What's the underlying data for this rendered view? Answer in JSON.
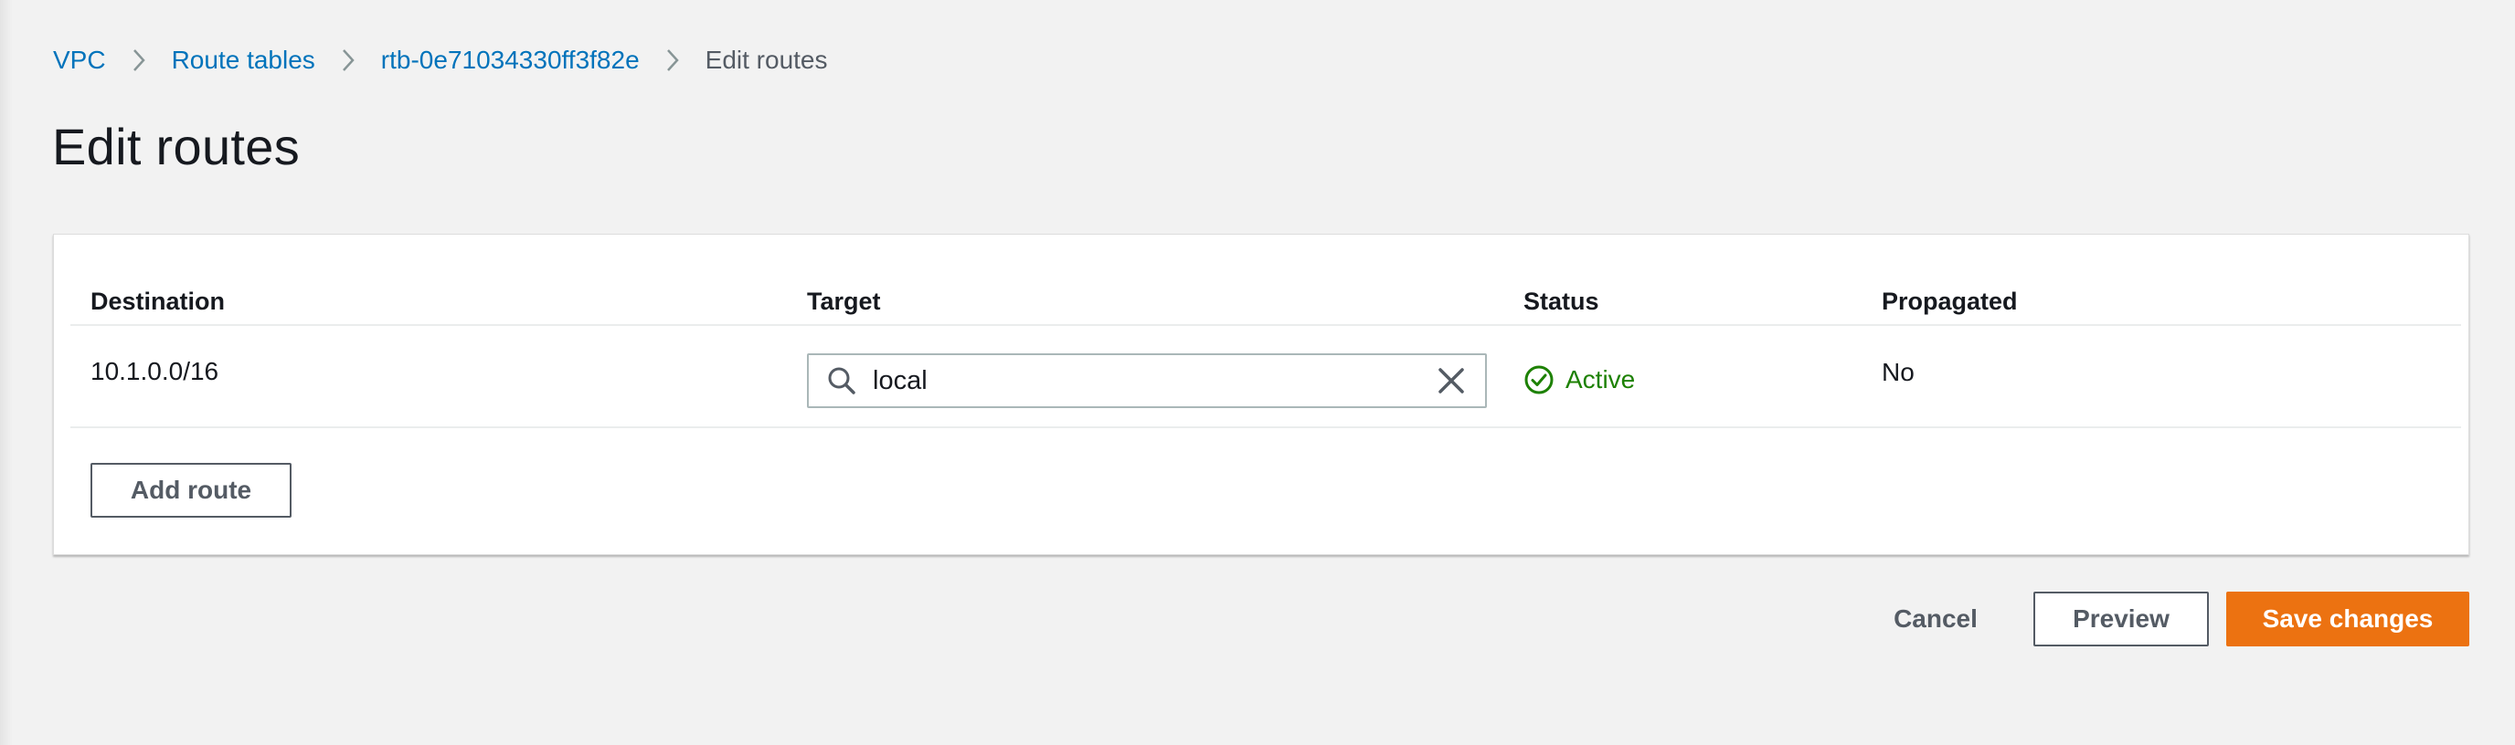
{
  "breadcrumb": {
    "items": [
      {
        "label": "VPC"
      },
      {
        "label": "Route tables"
      },
      {
        "label": "rtb-0e71034330ff3f82e"
      },
      {
        "label": "Edit routes"
      }
    ]
  },
  "page_title": "Edit routes",
  "routes_table": {
    "columns": [
      "Destination",
      "Target",
      "Status",
      "Propagated"
    ],
    "rows": [
      {
        "destination": "10.1.0.0/16",
        "target": "local",
        "status": "Active",
        "propagated": "No"
      }
    ],
    "add_route_label": "Add route"
  },
  "footer": {
    "cancel_label": "Cancel",
    "preview_label": "Preview",
    "save_label": "Save changes"
  },
  "icons": {
    "breadcrumb_separator": "chevron-right-icon",
    "target_search": "search-icon",
    "target_clear": "close-icon",
    "status": "check-circle-icon"
  },
  "colors": {
    "link": "#0073bb",
    "status_active": "#1d8102",
    "primary_button": "#ec7211",
    "page_background": "#f2f2f2"
  }
}
